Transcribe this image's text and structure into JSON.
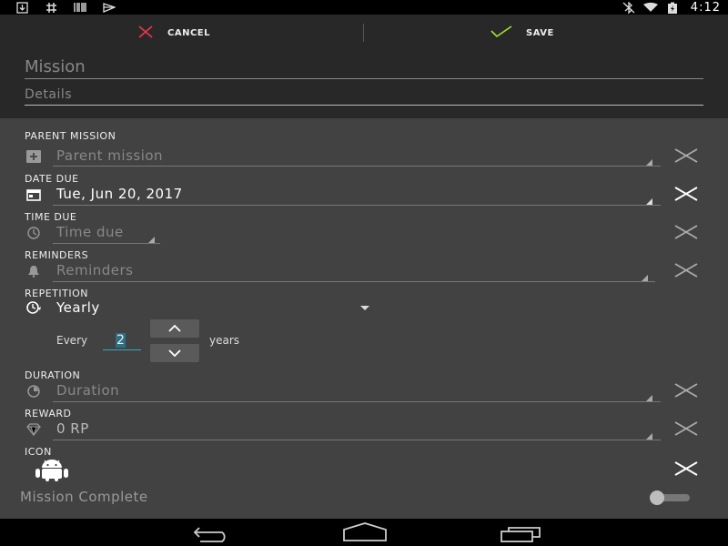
{
  "status_bar": {
    "left_icons": [
      "download-icon",
      "hash-icon",
      "barcode-icon",
      "notification-icon"
    ],
    "right_icons": [
      "bluetooth-off-icon",
      "wifi-icon",
      "battery-charging-icon"
    ],
    "time": "4:12"
  },
  "action_bar": {
    "cancel_label": "CANCEL",
    "save_label": "SAVE",
    "cancel_color": "#e5354b",
    "save_color": "#a6e22e"
  },
  "title": {
    "mission_placeholder": "Mission",
    "details_placeholder": "Details"
  },
  "fields": {
    "parent_mission": {
      "label": "PARENT MISSION",
      "placeholder": "Parent mission"
    },
    "date_due": {
      "label": "DATE DUE",
      "value": "Tue, Jun 20, 2017"
    },
    "time_due": {
      "label": "TIME DUE",
      "placeholder": "Time due"
    },
    "reminders": {
      "label": "REMINDERS",
      "placeholder": "Reminders"
    },
    "repetition": {
      "label": "REPETITION",
      "value": "Yearly",
      "every_label": "Every",
      "every_value": "2",
      "unit_label": "years"
    },
    "duration": {
      "label": "DURATION",
      "placeholder": "Duration"
    },
    "reward": {
      "label": "REWARD",
      "value": "0 RP"
    },
    "icon": {
      "label": "ICON",
      "icon_name": "android-icon"
    }
  },
  "mission_complete": {
    "label": "Mission Complete",
    "checked": false
  },
  "nav_bar": [
    "back-button",
    "home-button",
    "recents-button"
  ]
}
